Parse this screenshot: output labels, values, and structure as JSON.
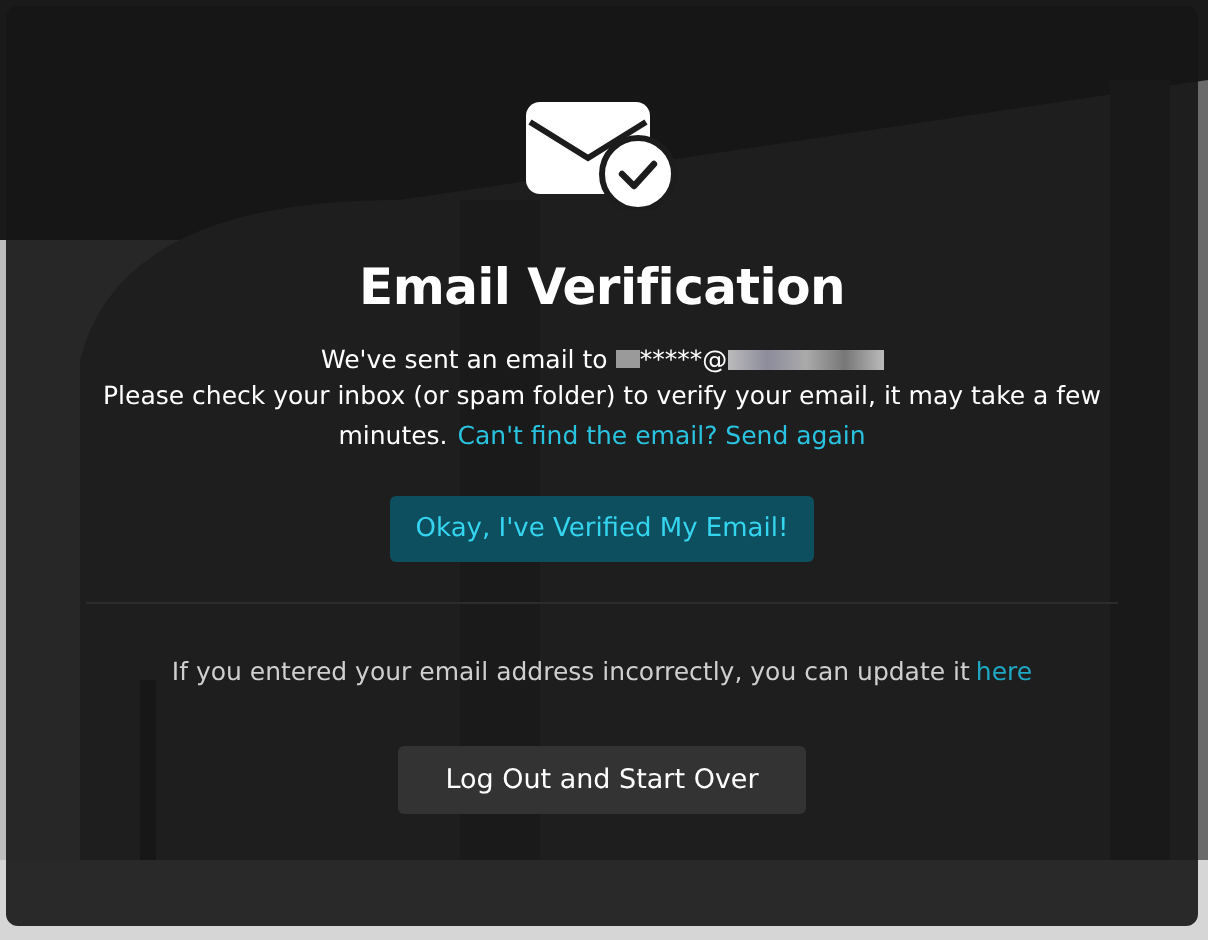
{
  "dialog": {
    "title": "Email Verification",
    "sent_text": "We've sent an email to",
    "email_visible": "*****@",
    "instructions": "Please check your inbox (or spam folder) to verify your email, it may take a few minutes.",
    "resend_link": "Can't find the email? Send again",
    "confirm_button": "Okay, I've Verified My Email!",
    "update_text": "If you entered your email address incorrectly, you can update it",
    "update_link": "here",
    "logout_button": "Log Out and Start Over"
  }
}
